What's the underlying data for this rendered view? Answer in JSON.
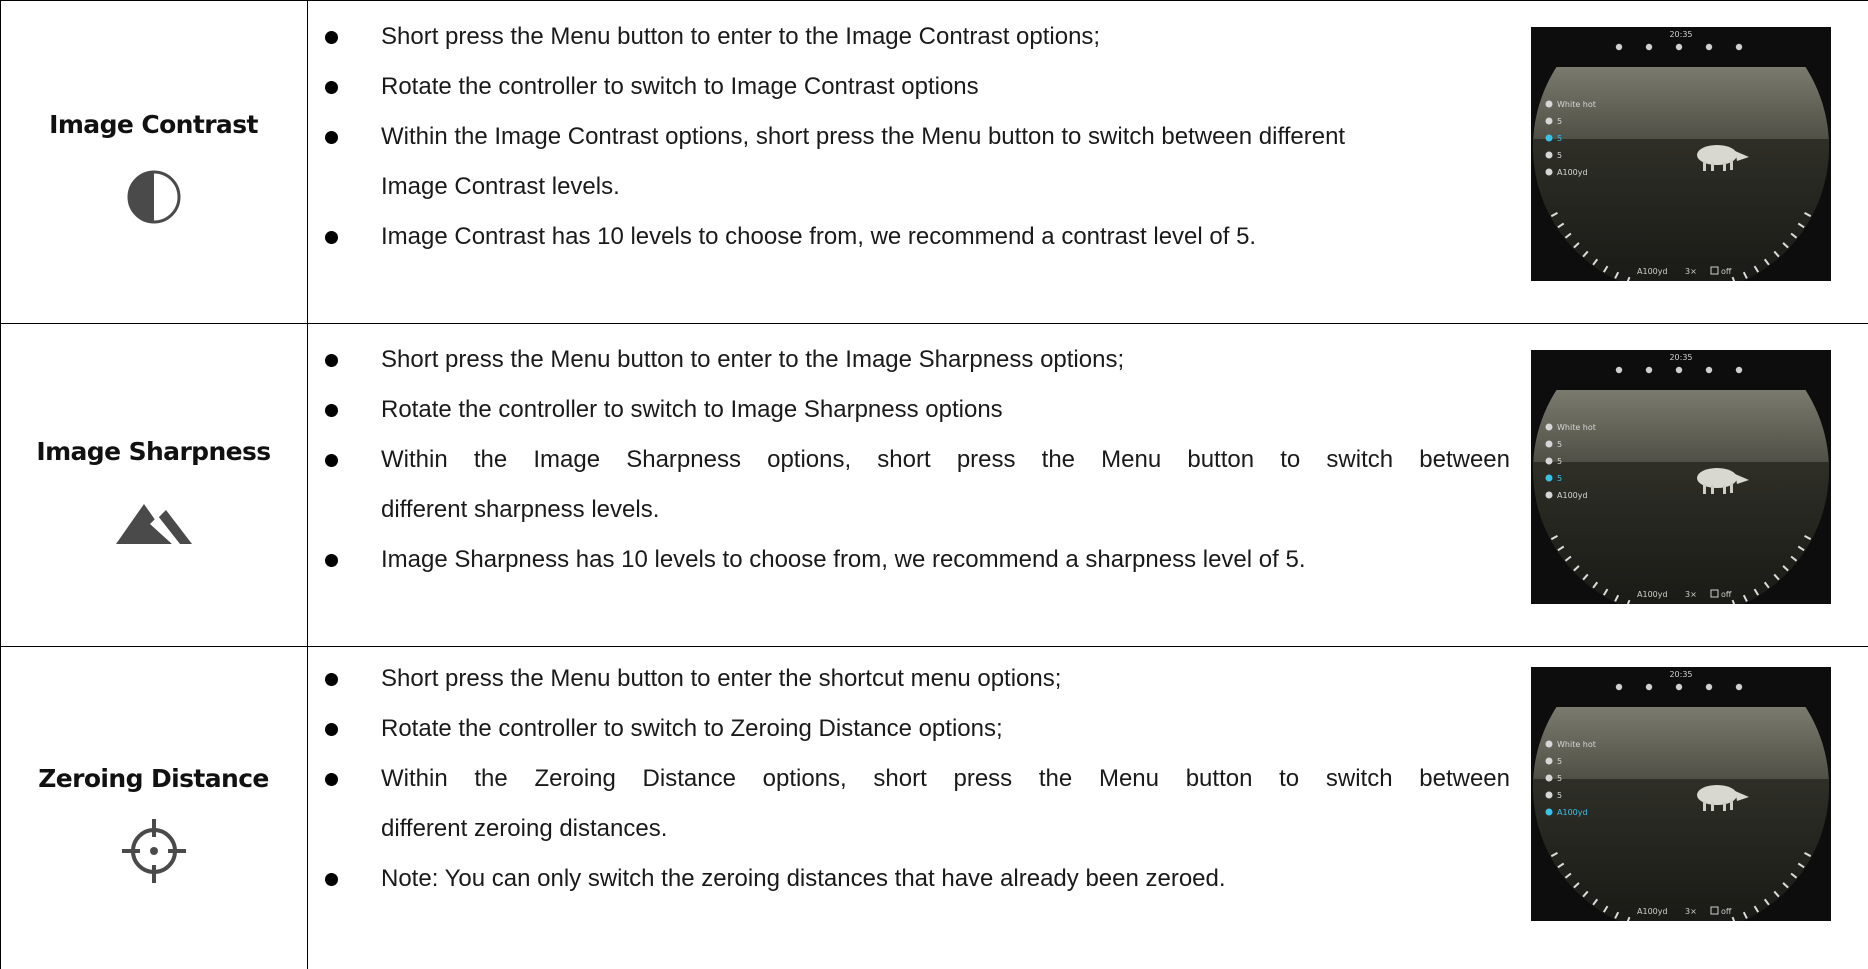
{
  "rows": [
    {
      "title": "Image Contrast",
      "icon": "contrast-icon",
      "bullets": [
        "Short press the Menu button to enter to the Image Contrast options;",
        "Rotate the controller to switch to Image Contrast options",
        "Within the Image Contrast options, short press the Menu button to switch between different",
        "Image Contrast levels.",
        "Image Contrast has 10 levels to choose from, we recommend a contrast level of 5."
      ],
      "screen": {
        "time": "20:35",
        "palette": "White hot",
        "brightness": "5",
        "contrast": "5",
        "sharpness": "5",
        "zero": "A100yd",
        "bottom_zero": "A100yd",
        "zoom": "3×",
        "pip": "off",
        "highlight": "contrast"
      }
    },
    {
      "title": "Image Sharpness",
      "icon": "sharpness-icon",
      "bullets": [
        "Short press the Menu button to enter to the Image Sharpness options;",
        "Rotate the controller to switch to Image Sharpness options",
        "Within the Image Sharpness options, short  press the Menu button to switch between",
        "different sharpness levels.",
        "Image Sharpness has 10 levels to choose from, we recommend a sharpness level of 5."
      ],
      "screen": {
        "time": "20:35",
        "palette": "White hot",
        "brightness": "5",
        "contrast": "5",
        "sharpness": "5",
        "zero": "A100yd",
        "bottom_zero": "A100yd",
        "zoom": "3×",
        "pip": "off",
        "highlight": "sharpness"
      }
    },
    {
      "title": "Zeroing Distance",
      "icon": "crosshair-icon",
      "bullets": [
        "Short press the Menu button to enter the shortcut menu options;",
        "Rotate the controller to switch to Zeroing Distance options;",
        "Within the Zeroing Distance options, short press the Menu button to switch between",
        "different zeroing distances.",
        "Note: You can only switch the zeroing distances that have already been zeroed."
      ],
      "screen": {
        "time": "20:35",
        "palette": "White hot",
        "brightness": "5",
        "contrast": "5",
        "sharpness": "5",
        "zero": "A100yd",
        "bottom_zero": "A100yd",
        "zoom": "3×",
        "pip": "off",
        "highlight": "zero"
      }
    }
  ],
  "colors": {
    "highlight": "#39c2e8",
    "icon": "#4a4a4a",
    "border": "#000000"
  }
}
